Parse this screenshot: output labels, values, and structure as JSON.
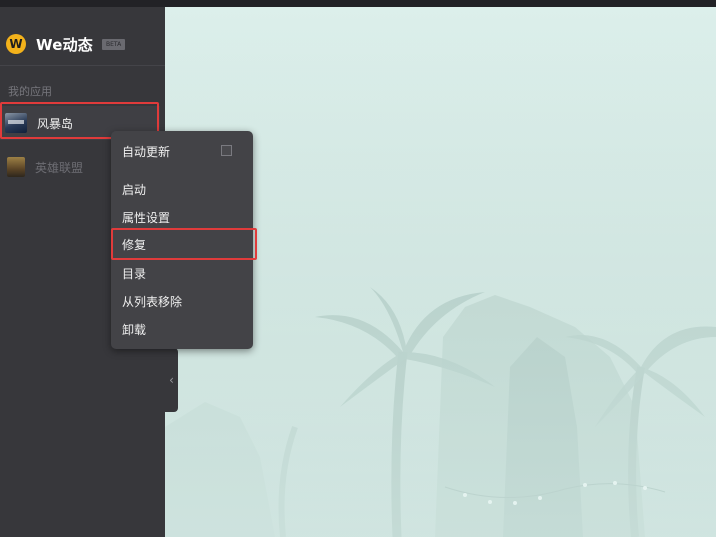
{
  "brand": {
    "name": "We动态",
    "badge": "BETA",
    "logo_letter": "W"
  },
  "sidebar": {
    "section_label": "我的应用",
    "apps": [
      {
        "label": "风暴岛",
        "icon": "fengbaodao-game-icon",
        "state": "selected"
      },
      {
        "label": "英雄联盟",
        "icon": "lol-game-icon",
        "state": "dimmed"
      }
    ],
    "collapse_glyph": "‹"
  },
  "context_menu": {
    "items": [
      {
        "label": "自动更新",
        "has_checkbox": true,
        "checked": false
      },
      {
        "label": "启动"
      },
      {
        "label": "属性设置"
      },
      {
        "label": "修复",
        "highlighted": true
      },
      {
        "label": "目录"
      },
      {
        "label": "从列表移除"
      },
      {
        "label": "卸载"
      }
    ]
  },
  "colors": {
    "highlight_border": "#e03b3b",
    "brand_yellow": "#f3b21b",
    "sidebar_bg": "#37373b",
    "menu_bg": "#434347"
  }
}
